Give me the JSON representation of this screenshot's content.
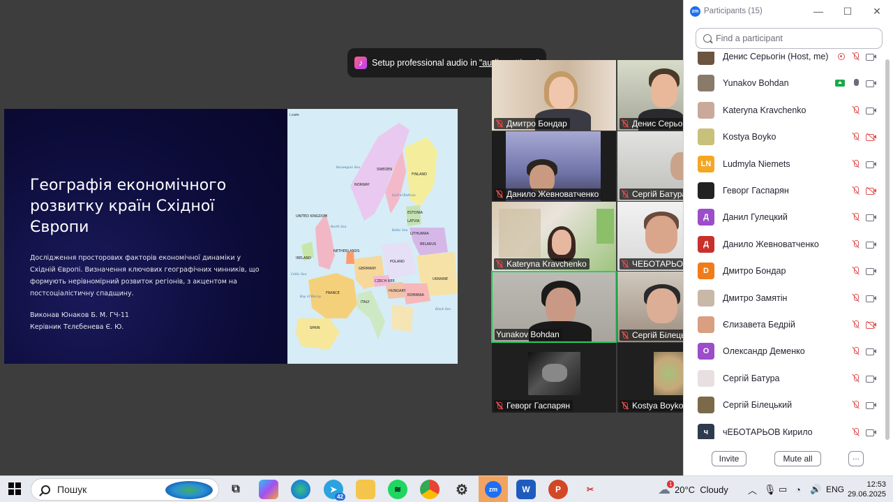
{
  "toast": {
    "text": "Setup professional audio in",
    "link": "\"audio settings\"",
    "icon": "music-note-icon"
  },
  "slide": {
    "title": "Географія економічного розвитку країн Східної Європи",
    "description": "Дослідження просторових факторів економічної динаміки у Східній Європі. Визначення ключових географічних чинників, що формують нерівномірний розвиток регіонів, з акцентом на постсоціалістичну спадщину.",
    "author": "Виконав Юнаков Б. М. ГЧ-11",
    "supervisor": "Керівник Тєлєбенева Є. Ю.",
    "map_labels": {
      "finland": "FINLAND",
      "sweden": "SWEDEN",
      "norway": "NORWAY",
      "uk": "UNITED KINGDOM",
      "ireland": "IRELAND",
      "germany": "GERMANY",
      "poland": "POLAND",
      "belarus": "BELARUS",
      "ukraine": "UKRAINE",
      "france": "FRANCE",
      "spain": "SPAIN",
      "italy": "ITALY",
      "romania": "ROMANIA",
      "netherlands": "NETHERLANDS",
      "czech": "CZECH REP.",
      "austria": "AUSTRIA",
      "estonia": "ESTONIA",
      "latvia": "LATVIA",
      "lithuania": "LITHUANIA",
      "hungary": "HUNGARY",
      "norwegian_sea": "Norwegian Sea",
      "north_sea": "North Sea",
      "baltic_sea": "Baltic Sea",
      "bay_of_biscay": "Bay of Biscay",
      "celtic_sea": "Celtic Sea",
      "black_sea": "Black Sea",
      "gulf_bothnia": "Gulf of Bothnia",
      "site": "i.com"
    }
  },
  "tiles": [
    {
      "name": "Дмитро Бондар",
      "muted": true
    },
    {
      "name": "Денис Серьогін",
      "muted": true
    },
    {
      "name": "Данило Жевноватченко",
      "muted": true
    },
    {
      "name": "Сергій Батура",
      "muted": true
    },
    {
      "name": "Kateryna Kravchenko",
      "muted": true
    },
    {
      "name": "ЧЕБОТАРЬОВ Кирило",
      "muted": true
    },
    {
      "name": "Yunakov Bohdan",
      "muted": false
    },
    {
      "name": "Сергій Білецький",
      "muted": true
    },
    {
      "name": "Геворг Гаспарян",
      "muted": true
    },
    {
      "name": "Kostya Boyko",
      "muted": true
    }
  ],
  "panel": {
    "title": "Participants (15)",
    "search_placeholder": "Find a participant",
    "invite": "Invite",
    "mute_all": "Mute all",
    "more": "···",
    "participants": [
      {
        "name": "Денис Серьогін (Host, me)",
        "avatar_text": "",
        "color": "#6b5540",
        "mic": "muted",
        "cam": "on",
        "extra": "rec"
      },
      {
        "name": "Yunakov Bohdan",
        "avatar_text": "",
        "color": "#8a7a6a",
        "mic": "on",
        "cam": "on",
        "extra": "share"
      },
      {
        "name": "Kateryna Kravchenko",
        "avatar_text": "",
        "color": "#c9a99a",
        "mic": "muted",
        "cam": "on",
        "extra": ""
      },
      {
        "name": "Kostya Boyko",
        "avatar_text": "",
        "color": "#c9c07a",
        "mic": "muted",
        "cam": "off",
        "extra": ""
      },
      {
        "name": "Ludmyla Niemets",
        "avatar_text": "LN",
        "color": "#f5a623",
        "mic": "muted",
        "cam": "on",
        "extra": ""
      },
      {
        "name": "Геворг Гаспарян",
        "avatar_text": "",
        "color": "#222222",
        "mic": "muted",
        "cam": "off",
        "extra": ""
      },
      {
        "name": "Данил Гулецкий",
        "avatar_text": "Д",
        "color": "#9b4dca",
        "mic": "muted",
        "cam": "on",
        "extra": ""
      },
      {
        "name": "Данило Жевноватченко",
        "avatar_text": "Д",
        "color": "#c9302c",
        "mic": "muted",
        "cam": "on",
        "extra": ""
      },
      {
        "name": "Дмитро Бондар",
        "avatar_text": "D",
        "color": "#f07b1a",
        "mic": "muted",
        "cam": "on",
        "extra": ""
      },
      {
        "name": "Дмитро Замятін",
        "avatar_text": "",
        "color": "#c8b8a8",
        "mic": "muted",
        "cam": "on",
        "extra": ""
      },
      {
        "name": "Єлизавета Бедрій",
        "avatar_text": "",
        "color": "#d8a080",
        "mic": "muted",
        "cam": "off",
        "extra": ""
      },
      {
        "name": "Олександр Деменко",
        "avatar_text": "О",
        "color": "#9b4dca",
        "mic": "muted",
        "cam": "on",
        "extra": ""
      },
      {
        "name": "Сергій Батура",
        "avatar_text": "",
        "color": "#e8e0e0",
        "mic": "muted",
        "cam": "on",
        "extra": ""
      },
      {
        "name": "Сергій Білецький",
        "avatar_text": "",
        "color": "#7a6a4a",
        "mic": "muted",
        "cam": "on",
        "extra": ""
      },
      {
        "name": "чЕБОТАРЬОВ Кирило",
        "avatar_text": "ч",
        "color": "#2e3a4e",
        "mic": "muted",
        "cam": "on",
        "extra": ""
      }
    ]
  },
  "taskbar": {
    "search_label": "Пошук",
    "telegram_badge": "42",
    "weather": "20°C  Cloudy",
    "weather_badge": "1",
    "lang": "ENG",
    "time": "12:53",
    "date": "29.06.2025"
  }
}
